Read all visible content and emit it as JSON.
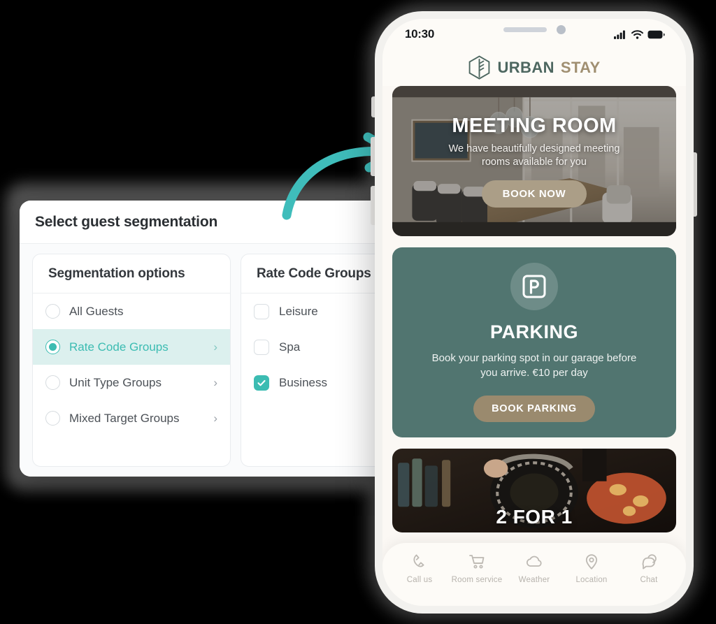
{
  "dialog": {
    "title": "Select guest segmentation",
    "left_panel": {
      "heading": "Segmentation options",
      "options": [
        {
          "label": "All Guests",
          "selected": false,
          "chevron": "",
          "icon": "radio-icon"
        },
        {
          "label": "Rate Code Groups",
          "selected": true,
          "chevron": "›",
          "icon": "radio-icon"
        },
        {
          "label": "Unit Type Groups",
          "selected": false,
          "chevron": "›",
          "icon": "radio-icon"
        },
        {
          "label": "Mixed Target Groups",
          "selected": false,
          "chevron": "›",
          "icon": "radio-icon"
        }
      ]
    },
    "right_panel": {
      "heading": "Rate Code Groups",
      "options": [
        {
          "label": "Leisure",
          "checked": false,
          "icon": "checkbox-icon"
        },
        {
          "label": "Spa",
          "checked": false,
          "icon": "checkbox-icon"
        },
        {
          "label": "Business",
          "checked": true,
          "icon": "checkbox-checked-icon"
        }
      ]
    }
  },
  "arrow": {
    "icon": "curved-arrow-icon",
    "color": "#3fbdbb"
  },
  "phone": {
    "status_bar": {
      "time": "10:30",
      "icons": [
        "cellular-signal-icon",
        "wifi-icon",
        "battery-full-icon"
      ]
    },
    "brand": {
      "name_primary": "URBAN",
      "name_secondary": "STAY",
      "logo_icon": "hexagon-tree-logo-icon"
    },
    "cards": [
      {
        "type": "hero",
        "title": "MEETING ROOM",
        "subtitle": "We have beautifully designed meeting rooms available for you",
        "button": "BOOK NOW"
      },
      {
        "type": "parking",
        "icon": "parking-p-icon",
        "title": "PARKING",
        "subtitle": "Book your parking spot in our garage before you arrive. €10 per day",
        "button": "BOOK PARKING"
      },
      {
        "type": "promo",
        "title": "2 FOR 1"
      }
    ],
    "tabbar": [
      {
        "label": "Call us",
        "icon": "phone-icon"
      },
      {
        "label": "Room service",
        "icon": "shopping-cart-icon"
      },
      {
        "label": "Weather",
        "icon": "cloud-icon"
      },
      {
        "label": "Location",
        "icon": "map-pin-icon"
      },
      {
        "label": "Chat",
        "icon": "chat-bubbles-icon"
      }
    ]
  },
  "colors": {
    "accent_teal": "#3cbcb2",
    "selected_row_bg": "#dcf0ee",
    "parking_green": "#517570",
    "button_tan": "#9a8a6e",
    "hero_button_tan": "#ab9e87",
    "brand_green": "#4d6760",
    "brand_tan": "#a08f71"
  }
}
